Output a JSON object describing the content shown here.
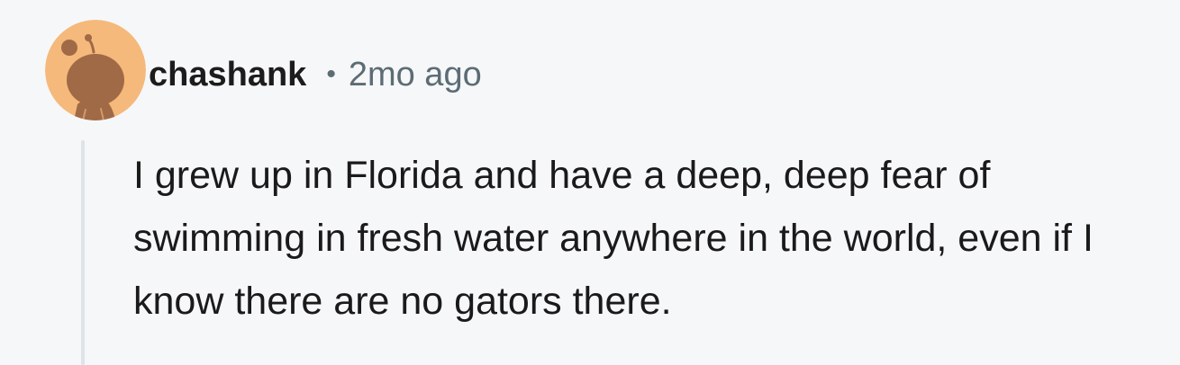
{
  "comment": {
    "author": "chashank",
    "separator": "•",
    "timestamp": "2mo ago",
    "body": "I grew up in Florida and have a deep, deep fear of swimming in fresh water anywhere in the world, even if I know there are no gators there.",
    "avatar_icon": "snoo-avatar-icon"
  },
  "colors": {
    "background": "#f6f7f9",
    "avatar_bg": "#f5b97b",
    "avatar_figure": "#a06a47",
    "username": "#1c1c1c",
    "meta": "#5c6c74",
    "thread_line": "#dde3e8"
  }
}
